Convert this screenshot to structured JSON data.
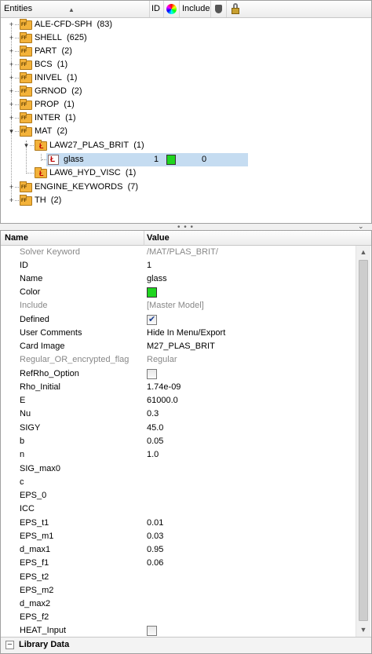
{
  "tree": {
    "header": {
      "entities": "Entities",
      "id": "ID",
      "include": "Include"
    },
    "rows": [
      {
        "label": "ALE-CFD-SPH",
        "count": "(83)"
      },
      {
        "label": "SHELL",
        "count": "(625)"
      },
      {
        "label": "PART",
        "count": "(2)"
      },
      {
        "label": "BCS",
        "count": "(1)"
      },
      {
        "label": "INIVEL",
        "count": "(1)"
      },
      {
        "label": "GRNOD",
        "count": "(2)"
      },
      {
        "label": "PROP",
        "count": "(1)"
      },
      {
        "label": "INTER",
        "count": "(1)"
      },
      {
        "label": "MAT",
        "count": "(2)"
      },
      {
        "label": "LAW27_PLAS_BRIT",
        "count": "(1)"
      },
      {
        "label": "glass",
        "id": "1",
        "include": "0",
        "color": "#1fd51f"
      },
      {
        "label": "LAW6_HYD_VISC",
        "count": "(1)"
      },
      {
        "label": "ENGINE_KEYWORDS",
        "count": "(7)"
      },
      {
        "label": "TH",
        "count": "(2)"
      }
    ]
  },
  "grid": {
    "header": {
      "name": "Name",
      "value": "Value"
    },
    "rows": [
      {
        "name": "Solver Keyword",
        "value": "/MAT/PLAS_BRIT/"
      },
      {
        "name": "ID",
        "value": "1"
      },
      {
        "name": "Name",
        "value": "glass"
      },
      {
        "name": "Color",
        "value": ""
      },
      {
        "name": "Include",
        "value": "[Master Model]"
      },
      {
        "name": "Defined",
        "value": ""
      },
      {
        "name": "User Comments",
        "value": "Hide In Menu/Export"
      },
      {
        "name": "Card Image",
        "value": "M27_PLAS_BRIT"
      },
      {
        "name": "Regular_OR_encrypted_flag",
        "value": "Regular"
      },
      {
        "name": "RefRho_Option",
        "value": ""
      },
      {
        "name": "Rho_Initial",
        "value": "1.74e-09"
      },
      {
        "name": "E",
        "value": "61000.0"
      },
      {
        "name": "Nu",
        "value": "0.3"
      },
      {
        "name": "SIGY",
        "value": "45.0"
      },
      {
        "name": "b",
        "value": "0.05"
      },
      {
        "name": "n",
        "value": "1.0"
      },
      {
        "name": "SIG_max0",
        "value": ""
      },
      {
        "name": "c",
        "value": ""
      },
      {
        "name": "EPS_0",
        "value": ""
      },
      {
        "name": "ICC",
        "value": ""
      },
      {
        "name": "EPS_t1",
        "value": "0.01"
      },
      {
        "name": "EPS_m1",
        "value": "0.03"
      },
      {
        "name": "d_max1",
        "value": "0.95"
      },
      {
        "name": "EPS_f1",
        "value": "0.06"
      },
      {
        "name": "EPS_t2",
        "value": ""
      },
      {
        "name": "EPS_m2",
        "value": ""
      },
      {
        "name": "d_max2",
        "value": ""
      },
      {
        "name": "EPS_f2",
        "value": ""
      },
      {
        "name": "HEAT_Input",
        "value": ""
      }
    ],
    "defined_checked": true,
    "refrho_checked": false,
    "heat_input_checked": false
  },
  "library": {
    "label": "Library Data"
  }
}
